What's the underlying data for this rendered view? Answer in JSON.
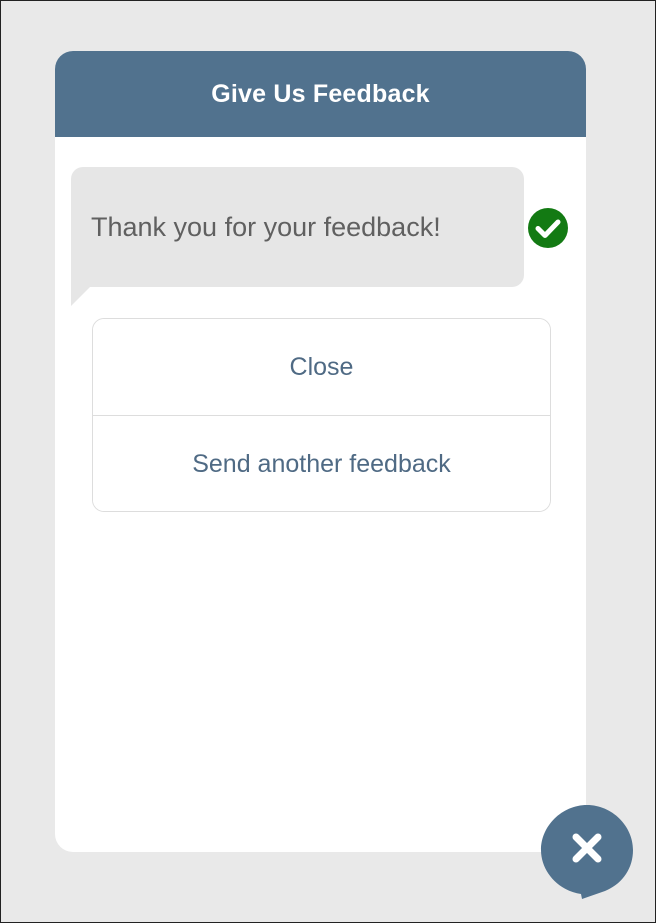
{
  "widget": {
    "title": "Give Us Feedback",
    "message": {
      "text": "Thank you for your feedback!",
      "status_icon": "check-circle-icon"
    },
    "actions": [
      {
        "label": "Close"
      },
      {
        "label": "Send another feedback"
      }
    ]
  },
  "fab": {
    "icon": "close-icon"
  },
  "colors": {
    "page_background": "#e9e9e9",
    "header_background": "#51728e",
    "header_text": "#ffffff",
    "bubble_background": "#e6e6e6",
    "bubble_text": "#606060",
    "action_text": "#4f6a84",
    "check_green": "#137a13",
    "fab_background": "#51728e"
  }
}
